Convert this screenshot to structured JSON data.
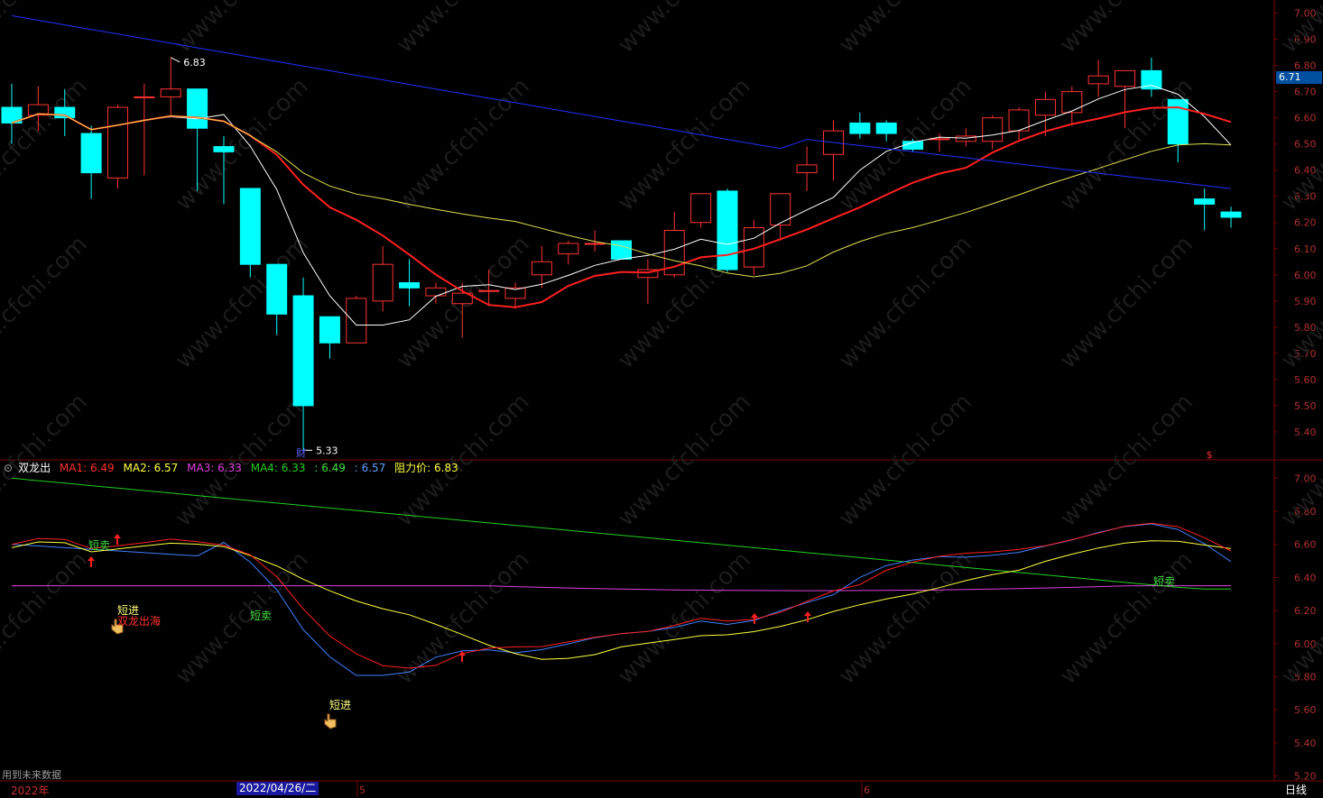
{
  "colors": {
    "up": "#ff3232",
    "down": "#00ffff",
    "grid": "#7a0000",
    "axis_text": "#b03030",
    "ma_white": "#ffffff",
    "ma_red": "#ff2020",
    "ma_yellow": "#e0e050",
    "ma_blue": "#2030ff",
    "ind_red": "#ff2020",
    "ind_yellow": "#ffff40",
    "ind_magenta": "#e040e0",
    "ind_green": "#20d020",
    "ind_blue": "#4080ff"
  },
  "price_tag": "6.71",
  "indicator": {
    "name": "双龙出",
    "ma1_label": "MA1: 6.49",
    "ma2_label": "MA2: 6.57",
    "ma3_label": "MA3: 6.33",
    "ma4_label": "MA4: 6.33",
    "extra1": ": 6.49",
    "extra2": ": 6.57",
    "resistance": "阻力价: 6.83"
  },
  "status": {
    "future_data": "用到未来数据",
    "year": "2022年",
    "date": "2022/04/26/二",
    "period": "日线"
  },
  "signals": [
    {
      "text": "短卖",
      "color": "#40e040",
      "dx": 98,
      "y": 603
    },
    {
      "text": "短进",
      "color": "#ffff80",
      "dx": 130,
      "y": 675
    },
    {
      "text": "双龙出海",
      "color": "#ff3030",
      "dx": 130,
      "y": 687
    },
    {
      "text": "短卖",
      "color": "#40e040",
      "dx": 277,
      "y": 681
    },
    {
      "text": "短进",
      "color": "#ffff80",
      "dx": 365,
      "y": 780
    },
    {
      "text": "短卖",
      "color": "#40e040",
      "dx": 1278,
      "y": 643
    }
  ],
  "chart_data": [
    {
      "type": "candlestick",
      "ylim": [
        5.3,
        7.05
      ],
      "yticks": [
        "7.00",
        "6.90",
        "6.80",
        "6.70",
        "6.60",
        "6.50",
        "6.40",
        "6.30",
        "6.20",
        "6.10",
        "6.00",
        "5.90",
        "5.80",
        "5.70",
        "5.60",
        "5.50",
        "5.40"
      ],
      "annotations": [
        {
          "text": "6.83",
          "value": 6.83
        },
        {
          "text": "5.33",
          "value": 5.33
        },
        {
          "text": "财"
        },
        {
          "text": "$"
        }
      ],
      "candles": [
        [
          6.64,
          6.73,
          6.5,
          6.58
        ],
        [
          6.61,
          6.72,
          6.55,
          6.65
        ],
        [
          6.64,
          6.71,
          6.53,
          6.6
        ],
        [
          6.54,
          6.57,
          6.29,
          6.39
        ],
        [
          6.37,
          6.65,
          6.33,
          6.64
        ],
        [
          6.68,
          6.73,
          6.38,
          6.68
        ],
        [
          6.68,
          6.83,
          6.61,
          6.71
        ],
        [
          6.71,
          6.71,
          6.32,
          6.56
        ],
        [
          6.49,
          6.53,
          6.27,
          6.47
        ],
        [
          6.33,
          6.33,
          5.99,
          6.04
        ],
        [
          6.04,
          6.04,
          5.77,
          5.85
        ],
        [
          5.92,
          5.99,
          5.33,
          5.5
        ],
        [
          5.84,
          5.84,
          5.68,
          5.74
        ],
        [
          5.74,
          5.92,
          5.74,
          5.91
        ],
        [
          5.9,
          6.11,
          5.86,
          6.04
        ],
        [
          5.97,
          6.06,
          5.88,
          5.95
        ],
        [
          5.92,
          5.97,
          5.89,
          5.95
        ],
        [
          5.89,
          5.97,
          5.76,
          5.93
        ],
        [
          5.94,
          6.02,
          5.88,
          5.94
        ],
        [
          5.91,
          5.97,
          5.87,
          5.95
        ],
        [
          6.0,
          6.11,
          5.95,
          6.05
        ],
        [
          6.08,
          6.13,
          6.04,
          6.12
        ],
        [
          6.12,
          6.17,
          6.09,
          6.12
        ],
        [
          6.13,
          6.13,
          6.06,
          6.06
        ],
        [
          5.99,
          6.06,
          5.89,
          6.02
        ],
        [
          6.0,
          6.24,
          5.99,
          6.17
        ],
        [
          6.2,
          6.29,
          6.18,
          6.31
        ],
        [
          6.32,
          6.33,
          6.01,
          6.02
        ],
        [
          6.03,
          6.21,
          6.0,
          6.18
        ],
        [
          6.19,
          6.31,
          6.13,
          6.31
        ],
        [
          6.39,
          6.49,
          6.32,
          6.42
        ],
        [
          6.46,
          6.59,
          6.36,
          6.55
        ],
        [
          6.58,
          6.62,
          6.52,
          6.54
        ],
        [
          6.58,
          6.59,
          6.51,
          6.54
        ],
        [
          6.51,
          6.52,
          6.47,
          6.48
        ],
        [
          6.52,
          6.54,
          6.47,
          6.52
        ],
        [
          6.51,
          6.56,
          6.49,
          6.53
        ],
        [
          6.51,
          6.61,
          6.48,
          6.6
        ],
        [
          6.55,
          6.64,
          6.51,
          6.63
        ],
        [
          6.61,
          6.7,
          6.53,
          6.67
        ],
        [
          6.62,
          6.72,
          6.57,
          6.7
        ],
        [
          6.73,
          6.82,
          6.68,
          6.76
        ],
        [
          6.72,
          6.78,
          6.56,
          6.78
        ],
        [
          6.78,
          6.83,
          6.68,
          6.71
        ],
        [
          6.67,
          6.67,
          6.43,
          6.5
        ],
        [
          6.29,
          6.33,
          6.17,
          6.27
        ],
        [
          6.24,
          6.26,
          6.18,
          6.22
        ]
      ]
    },
    {
      "type": "line",
      "name": "双龙出",
      "ylim": [
        5.17,
        7.1
      ],
      "yticks": [
        "7.00",
        "6.80",
        "6.60",
        "6.40",
        "6.20",
        "6.00",
        "5.80",
        "5.60",
        "5.40",
        "5.20"
      ],
      "series_x_index": true
    }
  ]
}
